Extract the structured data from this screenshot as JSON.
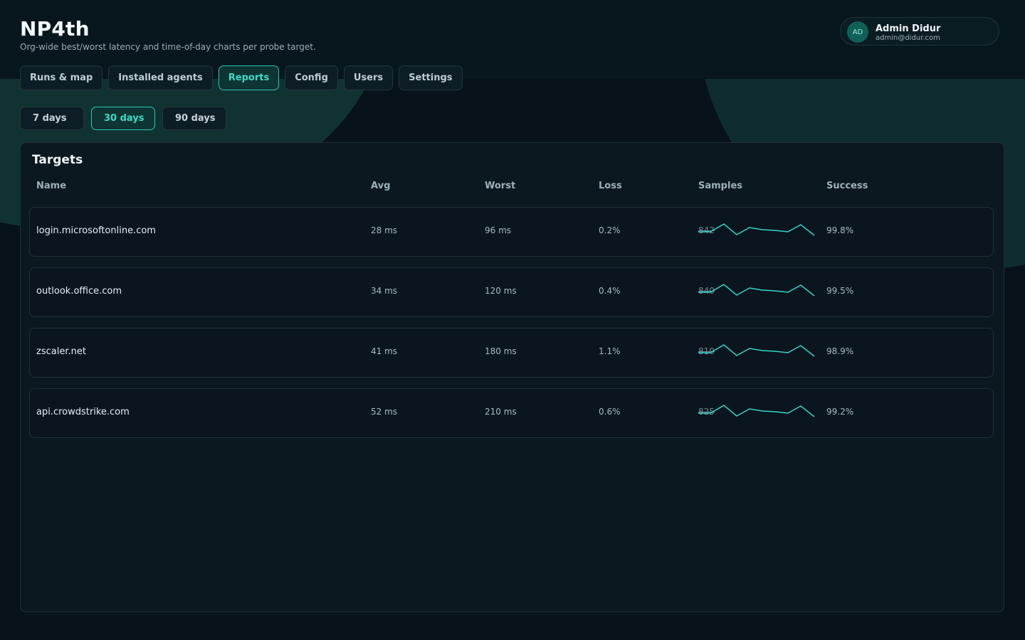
{
  "app": {
    "title": "NP4th",
    "subtitle": "Org-wide best/worst latency and time-of-day charts per probe target."
  },
  "user": {
    "initials": "AD",
    "name": "Admin Didur",
    "email": "admin@didur.com"
  },
  "tabs": [
    {
      "label": "Runs & map",
      "active": false
    },
    {
      "label": "Installed agents",
      "active": false
    },
    {
      "label": "Reports",
      "active": true
    },
    {
      "label": "Config",
      "active": false
    },
    {
      "label": "Users",
      "active": false
    },
    {
      "label": "Settings",
      "active": false
    }
  ],
  "ranges": [
    {
      "label": "7 days",
      "active": false
    },
    {
      "label": "30 days",
      "active": true
    },
    {
      "label": "90 days",
      "active": false
    }
  ],
  "targets": {
    "title": "Targets",
    "columns": {
      "name": "Name",
      "avg": "Avg",
      "worst": "Worst",
      "loss": "Loss",
      "samples": "Samples",
      "success": "Success"
    },
    "rows": [
      {
        "name": "login.microsoftonline.com",
        "avg": "28 ms",
        "worst": "96 ms",
        "loss": "0.2%",
        "samples": "842",
        "success": "99.8%"
      },
      {
        "name": "outlook.office.com",
        "avg": "34 ms",
        "worst": "120 ms",
        "loss": "0.4%",
        "samples": "840",
        "success": "99.5%"
      },
      {
        "name": "zscaler.net",
        "avg": "41 ms",
        "worst": "180 ms",
        "loss": "1.1%",
        "samples": "810",
        "success": "98.9%"
      },
      {
        "name": "api.crowdstrike.com",
        "avg": "52 ms",
        "worst": "210 ms",
        "loss": "0.6%",
        "samples": "825",
        "success": "99.2%"
      }
    ]
  },
  "colors": {
    "accent": "#28c7b6",
    "accent_text": "#41dbc8",
    "background": "#07121a",
    "panel": "#0b1820"
  },
  "icons": {
    "avatar": "avatar-initials",
    "sparkline": "sparkline-icon"
  }
}
